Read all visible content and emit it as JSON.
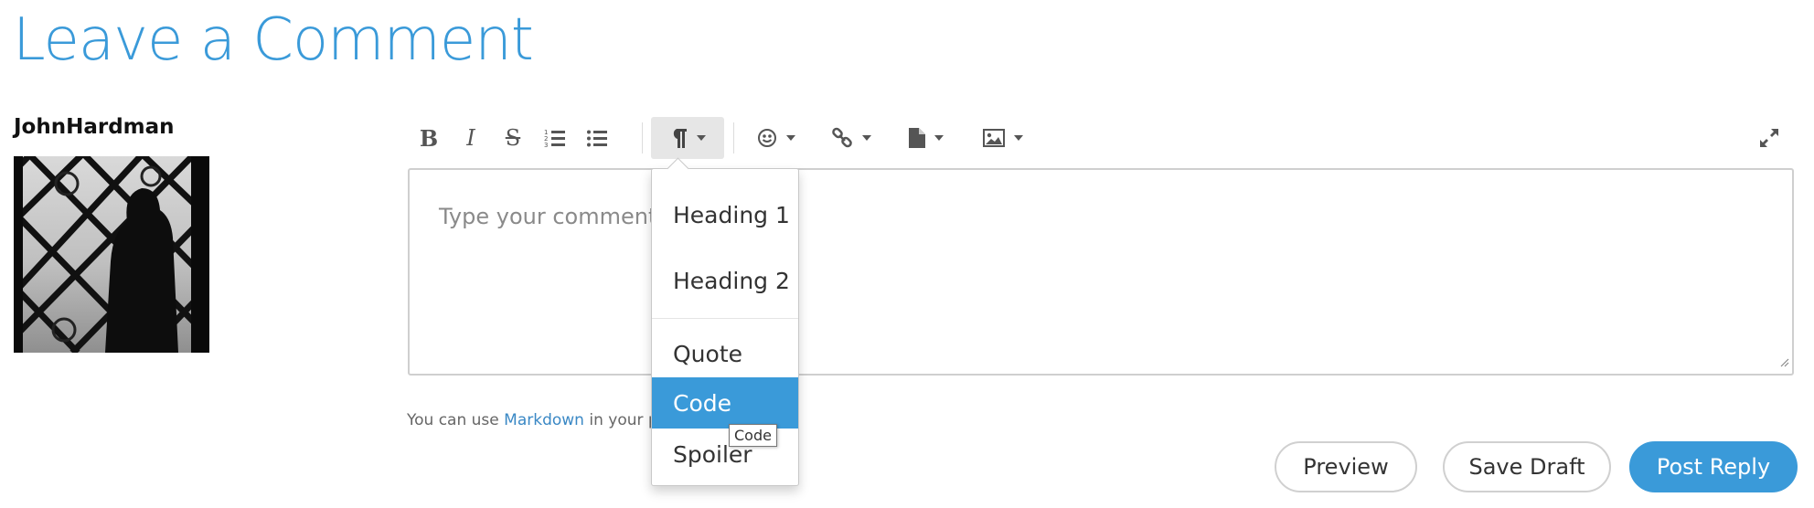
{
  "page": {
    "title": "Leave a Comment"
  },
  "user": {
    "name": "JohnHardman"
  },
  "toolbar": {
    "bold_label": "B",
    "italic_label": "I",
    "strike_label": "S",
    "icons": [
      "bold-icon",
      "italic-icon",
      "strikethrough-icon",
      "ordered-list-icon",
      "unordered-list-icon",
      "paragraph-icon",
      "emoji-icon",
      "link-icon",
      "file-icon",
      "image-icon",
      "fullscreen-icon"
    ]
  },
  "editor": {
    "placeholder": "Type your comment"
  },
  "help": {
    "prefix": "You can use ",
    "link": "Markdown",
    "suffix": " in your po"
  },
  "dropdown": {
    "items": [
      {
        "label": "Heading 1"
      },
      {
        "label": "Heading 2"
      },
      {
        "label": "Quote"
      },
      {
        "label": "Code"
      },
      {
        "label": "Spoiler"
      }
    ],
    "selected": "Code"
  },
  "tooltip": {
    "text": "Code"
  },
  "buttons": {
    "preview": "Preview",
    "save_draft": "Save Draft",
    "post_reply": "Post Reply"
  },
  "colors": {
    "accent": "#3a9ad9",
    "link": "#3a88c5"
  }
}
